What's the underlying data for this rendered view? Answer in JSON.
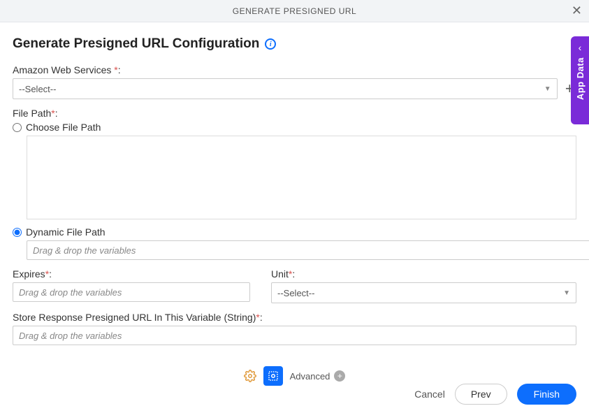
{
  "modal": {
    "title": "GENERATE PRESIGNED URL"
  },
  "page": {
    "heading": "Generate Presigned URL Configuration"
  },
  "fields": {
    "aws": {
      "label": "Amazon Web Services ",
      "selected": "--Select--"
    },
    "filepath": {
      "label": "File Path",
      "choose_label": "Choose File Path",
      "dynamic_label": "Dynamic File Path",
      "dynamic_placeholder": "Drag & drop the variables"
    },
    "expires": {
      "label": "Expires",
      "placeholder": "Drag & drop the variables"
    },
    "unit": {
      "label": "Unit",
      "selected": "--Select--"
    },
    "store": {
      "label": "Store Response Presigned URL In This Variable (String)",
      "placeholder": "Drag & drop the variables"
    }
  },
  "bottom": {
    "advanced": "Advanced"
  },
  "buttons": {
    "cancel": "Cancel",
    "prev": "Prev",
    "finish": "Finish"
  },
  "sidetab": {
    "label": "App Data"
  },
  "req": "*",
  "colon": ":"
}
